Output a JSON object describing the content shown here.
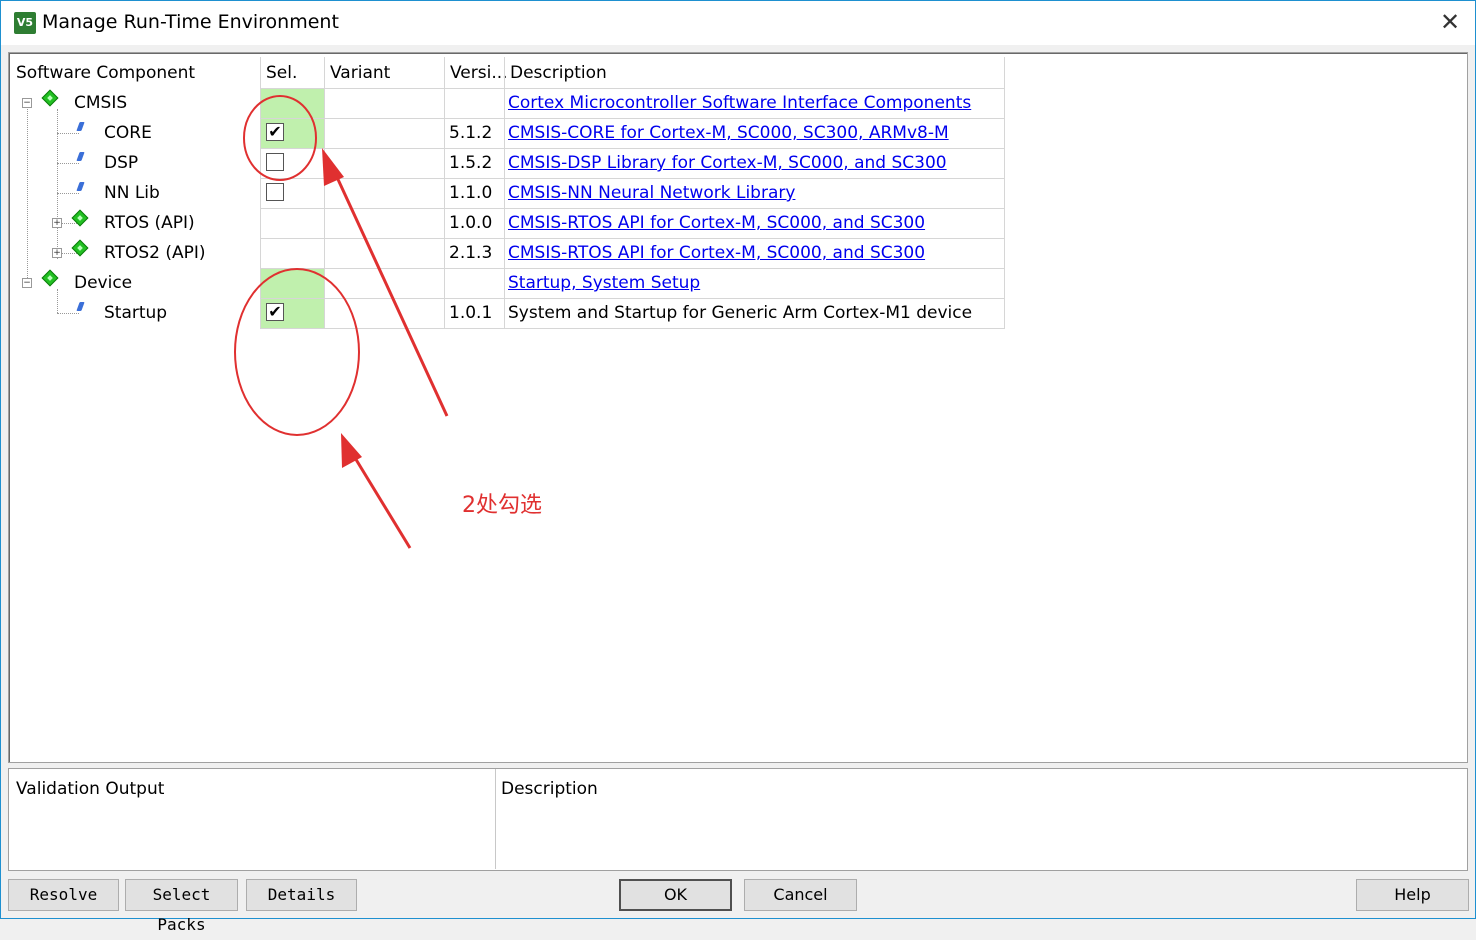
{
  "window": {
    "title": "Manage Run-Time Environment",
    "app_icon_text": "V5"
  },
  "columns": [
    "Software Component",
    "Sel.",
    "Variant",
    "Versi...",
    "Description"
  ],
  "rows": [
    {
      "name": "CMSIS",
      "version": "",
      "description": "Cortex Microcontroller Software Interface Components",
      "link": true
    },
    {
      "name": "CORE",
      "version": "5.1.2",
      "description": "CMSIS-CORE for Cortex-M, SC000, SC300, ARMv8-M",
      "link": true,
      "checked": "✔"
    },
    {
      "name": "DSP",
      "version": "1.5.2",
      "description": "CMSIS-DSP Library for Cortex-M, SC000, and SC300",
      "link": true,
      "checked": ""
    },
    {
      "name": "NN Lib",
      "version": "1.1.0",
      "description": "CMSIS-NN Neural Network Library",
      "link": true,
      "checked": ""
    },
    {
      "name": "RTOS (API)",
      "version": "1.0.0",
      "description": "CMSIS-RTOS API for Cortex-M, SC000, and SC300",
      "link": true
    },
    {
      "name": "RTOS2 (API)",
      "version": "2.1.3",
      "description": "CMSIS-RTOS API for Cortex-M, SC000, and SC300",
      "link": true
    },
    {
      "name": "Device",
      "version": "",
      "description": "Startup, System Setup",
      "link": true
    },
    {
      "name": "Startup",
      "version": "1.0.1",
      "description": "System and Startup for Generic Arm Cortex-M1 device",
      "link": false,
      "checked": "✔"
    }
  ],
  "validation": {
    "output_header": "Validation Output",
    "description_header": "Description"
  },
  "buttons": {
    "resolve": "Resolve",
    "select_packs": "Select Packs",
    "details": "Details",
    "ok": "OK",
    "cancel": "Cancel",
    "help": "Help"
  },
  "annotation": {
    "text": "2处勾选",
    "color": "#e03030"
  },
  "colors": {
    "selection_green": "#c0f0ad",
    "link_blue": "#0000ee",
    "window_border": "#1e90d0"
  }
}
